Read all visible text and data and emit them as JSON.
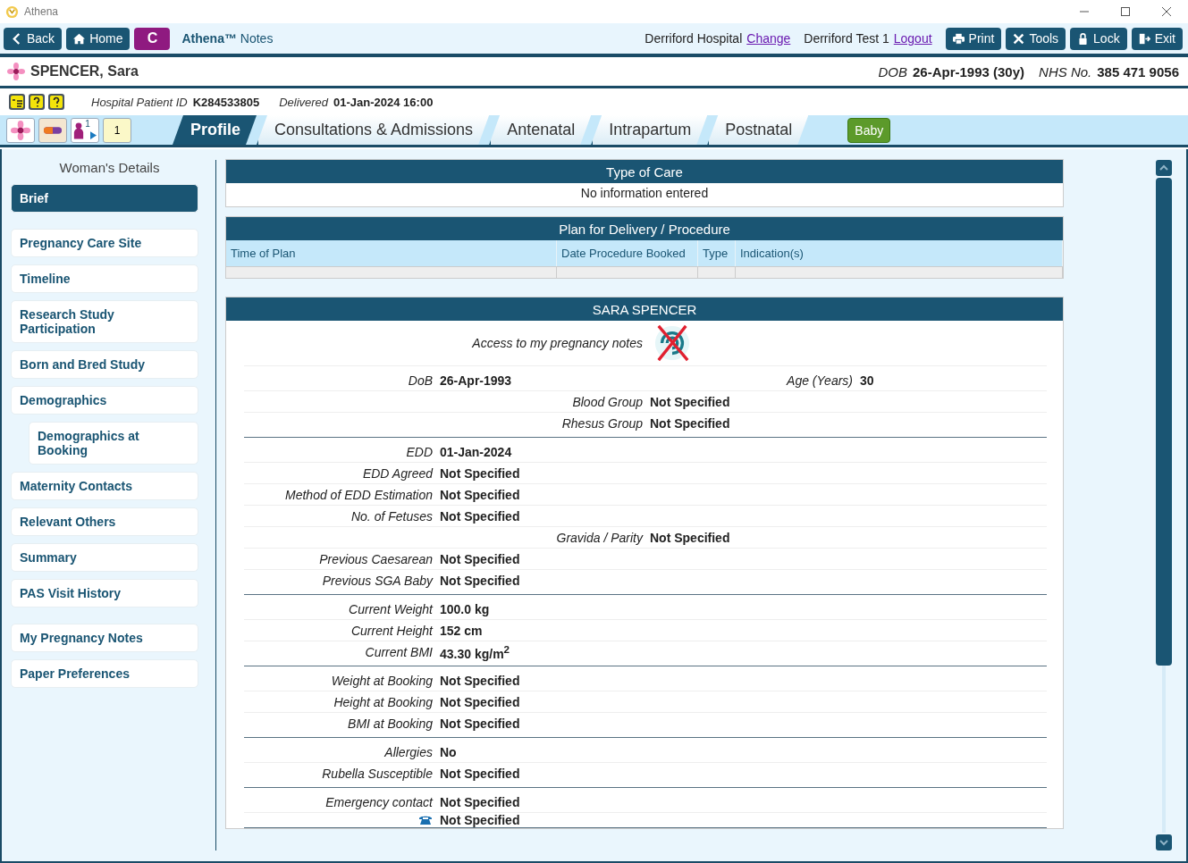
{
  "window": {
    "title": "Athena"
  },
  "toolbar": {
    "nav_buttons": [
      {
        "kind": "back",
        "label": "Back"
      },
      {
        "kind": "home",
        "label": "Home"
      },
      {
        "kind": "letter",
        "label": "C"
      }
    ],
    "app_name": "**Athena™** Notes",
    "site": {
      "name": "Derriford Hospital",
      "link": "Change"
    },
    "user": {
      "name": "Derriford Test 1",
      "link": "Logout"
    },
    "action_buttons": [
      {
        "kind": "print",
        "label": "Print"
      },
      {
        "kind": "tools",
        "label": "Tools"
      },
      {
        "kind": "lock",
        "label": "Lock"
      },
      {
        "kind": "exit",
        "label": "Exit"
      }
    ]
  },
  "patient": {
    "name": "SPENCER, Sara",
    "dob_label": "DOB",
    "dob": "26-Apr-1993 (30y)",
    "nhs_label": "NHS No.",
    "nhs": "385 471 9056",
    "id_label": "Hospital Patient ID",
    "id": "K284533805",
    "delivered_label": "Delivered",
    "delivered": "01-Jan-2024 16:00"
  },
  "icon_buttons": [
    {
      "kind": "flower"
    },
    {
      "kind": "capsule"
    },
    {
      "kind": "person",
      "text": "1"
    },
    {
      "kind": "notepad",
      "text": "1"
    }
  ],
  "tabs": [
    {
      "label": "Profile",
      "selected": true
    },
    {
      "label": "Consultations & Admissions",
      "selected": false
    },
    {
      "label": "Antenatal",
      "selected": false
    },
    {
      "label": "Intrapartum",
      "selected": false
    },
    {
      "label": "Postnatal",
      "selected": false
    }
  ],
  "baby_button": "Baby",
  "sidebar": {
    "title": "Woman's Details",
    "groups": [
      [
        {
          "label": "Brief",
          "selected": true
        }
      ],
      [
        {
          "label": "Pregnancy Care Site",
          "selected": false
        },
        {
          "label": "Timeline",
          "selected": false
        },
        {
          "label": "Research Study Participation",
          "selected": false
        },
        {
          "label": "Born and Bred Study",
          "selected": false
        },
        {
          "label": "Demographics",
          "selected": false,
          "children": [
            {
              "label": "Demographics at Booking",
              "selected": false
            }
          ]
        },
        {
          "label": "Maternity Contacts",
          "selected": false
        },
        {
          "label": "Relevant Others",
          "selected": false
        },
        {
          "label": "Summary",
          "selected": false
        },
        {
          "label": "PAS Visit History",
          "selected": false
        }
      ],
      [
        {
          "label": "My Pregnancy Notes",
          "selected": false
        },
        {
          "label": "Paper Preferences",
          "selected": false
        }
      ]
    ]
  },
  "type_of_care": {
    "title": "Type of Care",
    "message": "No information entered"
  },
  "plan": {
    "title": "Plan for Delivery / Procedure",
    "columns": [
      "Time of Plan",
      "Date Procedure Booked",
      "Type",
      "Indication(s)"
    ]
  },
  "patient_card": {
    "title": "SARA SPENCER",
    "access_label": "Access to my pregnancy notes",
    "access_enabled": false,
    "sections": [
      [
        {
          "kind": "pair",
          "items": [
            {
              "label": "DoB",
              "value": "26-Apr-1993"
            },
            {
              "label": "Age (Years)",
              "value": "30"
            }
          ]
        },
        {
          "kind": "center",
          "label": "Blood Group",
          "value": "Not Specified"
        },
        {
          "kind": "center",
          "label": "Rhesus Group",
          "value": "Not Specified"
        }
      ],
      [
        {
          "kind": "left",
          "label": "EDD",
          "value": "01-Jan-2024"
        },
        {
          "kind": "left",
          "label": "EDD Agreed",
          "value": "Not Specified"
        },
        {
          "kind": "left",
          "label": "Method of EDD Estimation",
          "value": "Not Specified"
        },
        {
          "kind": "left",
          "label": "No. of Fetuses",
          "value": "Not Specified"
        },
        {
          "kind": "center",
          "label": "Gravida / Parity",
          "value": "Not Specified"
        },
        {
          "kind": "left",
          "label": "Previous Caesarean",
          "value": "Not Specified"
        },
        {
          "kind": "left",
          "label": "Previous SGA Baby",
          "value": "Not Specified"
        }
      ],
      [
        {
          "kind": "left",
          "label": "Current Weight",
          "value": "100.0 kg"
        },
        {
          "kind": "left",
          "label": "Current Height",
          "value": "152 cm"
        },
        {
          "kind": "left",
          "label": "Current BMI",
          "value": "43.30 kg/m$^{2}$"
        }
      ],
      [
        {
          "kind": "left",
          "label": "Weight at Booking",
          "value": "Not Specified"
        },
        {
          "kind": "left",
          "label": "Height at Booking",
          "value": "Not Specified"
        },
        {
          "kind": "left",
          "label": "BMI at Booking",
          "value": "Not Specified"
        }
      ],
      [
        {
          "kind": "left",
          "label": "Allergies",
          "value": "No"
        },
        {
          "kind": "left",
          "label": "Rubella Susceptible",
          "value": "Not Specified"
        }
      ],
      [
        {
          "kind": "left",
          "label": "Emergency contact",
          "value": "Not Specified"
        },
        {
          "kind": "phone",
          "value": "Not Specified"
        }
      ]
    ]
  }
}
